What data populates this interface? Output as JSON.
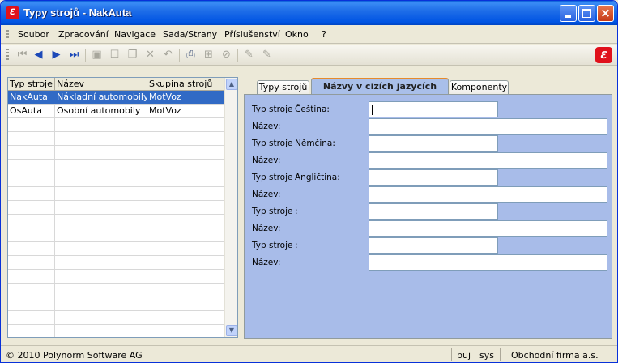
{
  "window": {
    "title": "Typy strojů - NakAuta",
    "app_icon_text": "ℇ"
  },
  "menu": {
    "items": [
      "Soubor",
      "Zpracování",
      "Navigace",
      "Sada/Strany",
      "Příslušenství",
      "Okno",
      "?"
    ]
  },
  "toolbar": {
    "icons": [
      "first-record-icon",
      "previous-record-icon",
      "next-record-icon",
      "last-record-icon",
      "save-icon",
      "new-icon",
      "copy-icon",
      "delete-icon",
      "undo-icon",
      "print-icon",
      "tree-icon",
      "disabled-icon",
      "edit-icon",
      "edit-alt-icon"
    ],
    "brand_logo_text": "ℇ"
  },
  "grid": {
    "columns": [
      "Typ stroje",
      "Název",
      "Skupina strojů"
    ],
    "rows": [
      {
        "typ": "NakAuta",
        "nazev": "Nákladní automobily",
        "skupina": "MotVoz",
        "selected": true
      },
      {
        "typ": "OsAuta",
        "nazev": "Osobní automobily",
        "skupina": "MotVoz",
        "selected": false
      }
    ]
  },
  "tabs": [
    {
      "label": "Typy strojů",
      "active": false
    },
    {
      "label": "Názvy v cizích jazycích",
      "active": true
    },
    {
      "label": "Komponenty",
      "active": false
    }
  ],
  "form": {
    "type_label": "Typ stroje",
    "name_label": "Název:",
    "languages": [
      {
        "lang": "Čeština:",
        "type_value": "",
        "name_value": ""
      },
      {
        "lang": "Němčina:",
        "type_value": "",
        "name_value": ""
      },
      {
        "lang": "Angličtina:",
        "type_value": "",
        "name_value": ""
      },
      {
        "lang": ":",
        "type_value": "",
        "name_value": ""
      },
      {
        "lang": ":",
        "type_value": "",
        "name_value": ""
      }
    ]
  },
  "status": {
    "copyright": "© 2010 Polynorm Software AG",
    "user1": "buj",
    "user2": "sys",
    "company": "Obchodní firma a.s."
  }
}
